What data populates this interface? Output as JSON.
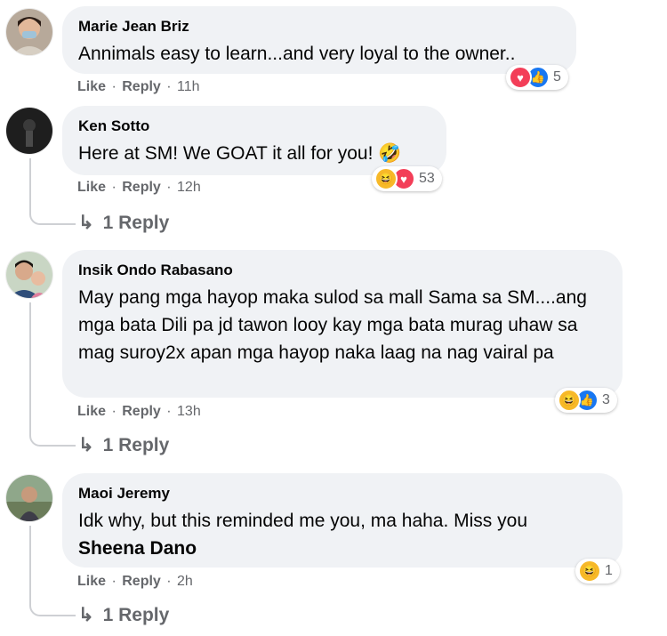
{
  "comments": [
    {
      "author": "Marie Jean Briz",
      "text": "Annimals easy to learn...and very loyal to the owner..",
      "like_label": "Like",
      "reply_label": "Reply",
      "time": "11h",
      "reactions": [
        "love",
        "like"
      ],
      "reaction_count": "5"
    },
    {
      "author": "Ken Sotto",
      "text": "Here at SM! We GOAT it all for you! 🤣",
      "like_label": "Like",
      "reply_label": "Reply",
      "time": "12h",
      "reactions": [
        "haha",
        "love"
      ],
      "reaction_count": "53",
      "replies_label": "1 Reply"
    },
    {
      "author": "Insik Ondo Rabasano",
      "text": "May pang mga hayop maka sulod sa mall Sama sa SM....ang mga bata Dili pa jd tawon looy kay mga bata murag uhaw sa mag suroy2x apan mga hayop naka laag na nag vairal pa",
      "like_label": "Like",
      "reply_label": "Reply",
      "time": "13h",
      "reactions": [
        "haha",
        "like"
      ],
      "reaction_count": "3",
      "replies_label": "1 Reply"
    },
    {
      "author": "Maoi Jeremy",
      "text": "Idk why, but this reminded me you, ma haha. Miss you",
      "mention": "Sheena Dano",
      "like_label": "Like",
      "reply_label": "Reply",
      "time": "2h",
      "reactions": [
        "haha"
      ],
      "reaction_count": "1",
      "replies_label": "1 Reply"
    }
  ],
  "colors": {
    "bubble_bg": "#f0f2f5",
    "meta_text": "#65676b",
    "love": "#f33e58",
    "like": "#1877f2",
    "haha": "#f7b928"
  }
}
